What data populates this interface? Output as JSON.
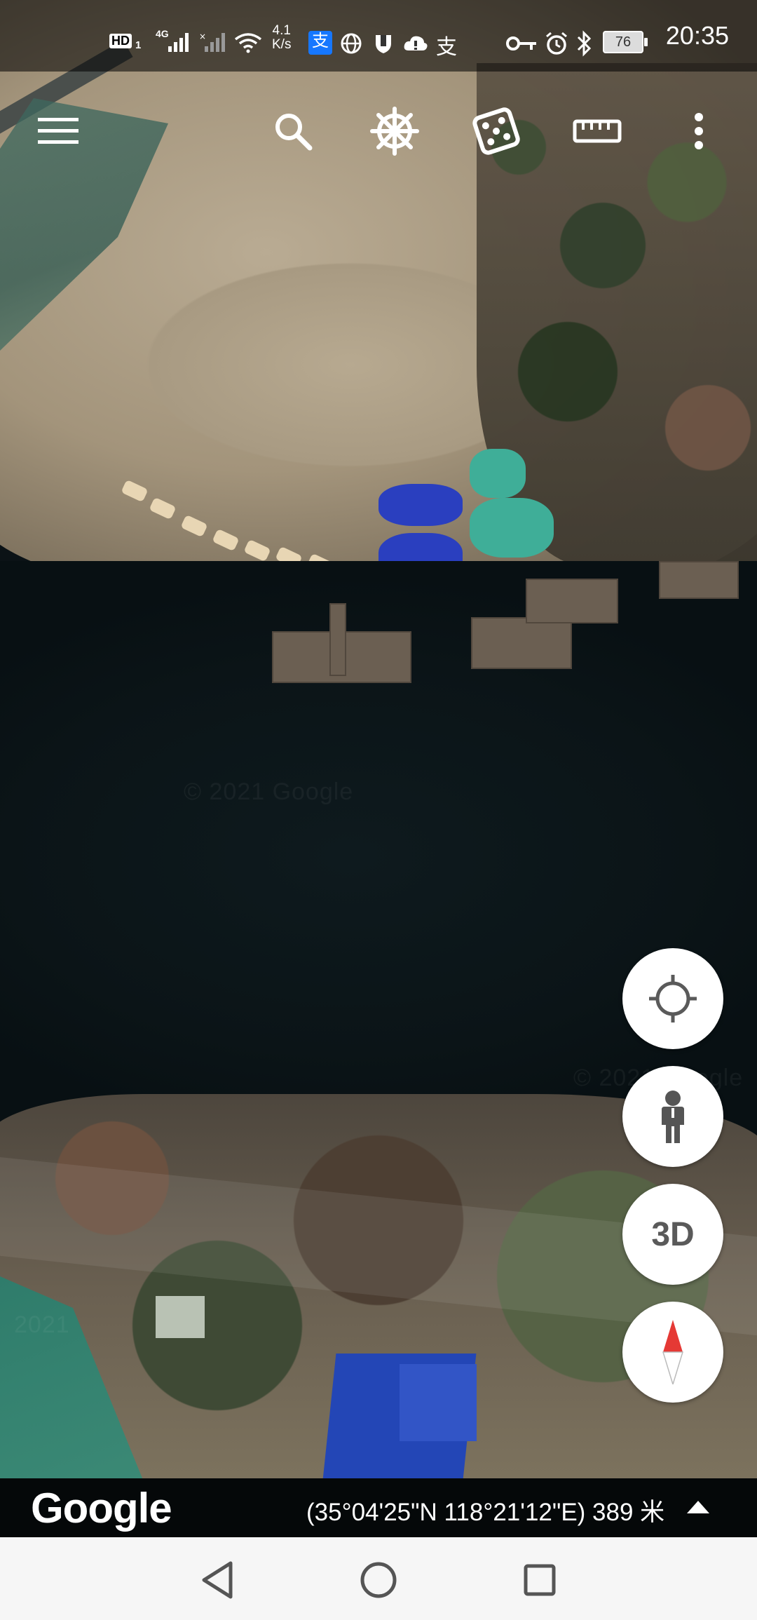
{
  "status_bar": {
    "hd_badge": "HD",
    "sim_index": "1",
    "network_type": "4G",
    "net_speed_value": "4.1",
    "net_speed_unit": "K/s",
    "battery_level": "76",
    "time": "20:35",
    "icons": [
      "hd-icon",
      "signal-icon",
      "no-signal-icon",
      "wifi-icon",
      "alipay-icon",
      "globe-icon",
      "shield-icon",
      "cloud-icon",
      "alipay-icon",
      "key-icon",
      "alarm-icon",
      "bluetooth-icon",
      "battery-icon"
    ]
  },
  "toolbar": {
    "icons": [
      "menu-icon",
      "search-icon",
      "voyager-wheel-icon",
      "dice-icon",
      "ruler-icon",
      "more-vert-icon"
    ]
  },
  "map": {
    "watermarks": [
      "© 2021 Google",
      "© 2021 Google",
      "2021"
    ]
  },
  "fab": {
    "my_location_icon": "crosshair-icon",
    "street_view_icon": "pegman-icon",
    "three_d_label": "3D",
    "compass_icon": "compass-icon"
  },
  "map_footer": {
    "logo_text": "Google",
    "coordinates": "(35°04'25\"N 118°21'12\"E) 389 米",
    "expand_icon": "chevron-up-icon"
  },
  "nav_bar": {
    "icons": [
      "back-icon",
      "home-icon",
      "recents-icon"
    ]
  },
  "colors": {
    "compass_red": "#e53935",
    "fab_background": "#ffffff",
    "icon_white": "#ffffff"
  }
}
